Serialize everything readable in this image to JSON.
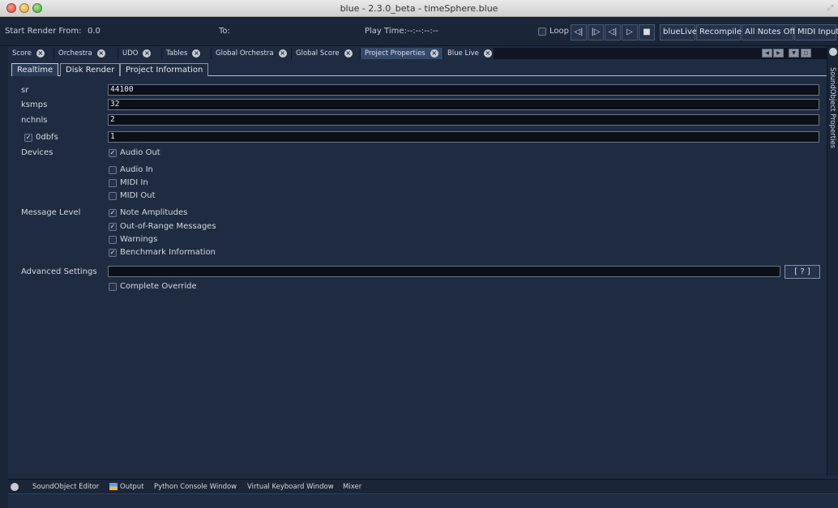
{
  "window": {
    "title": "blue - 2.3.0_beta - timeSphere.blue"
  },
  "toolbar": {
    "start_label": "Start Render From:",
    "start_value": "0.0",
    "to_label": "To:",
    "play_time_label": "Play Time:",
    "play_time_value": "--:--:--:--",
    "loop_label": "Loop",
    "transport_icons": [
      "rewind-icon",
      "step-forward-icon",
      "step-back-icon",
      "play-icon",
      "stop-icon"
    ],
    "buttons": [
      "blueLive",
      "Recompile",
      "All Notes Off",
      "MIDI Input"
    ]
  },
  "main_tabs": [
    {
      "label": "Score"
    },
    {
      "label": "Orchestra"
    },
    {
      "label": "UDO"
    },
    {
      "label": "Tables"
    },
    {
      "label": "Global Orchestra"
    },
    {
      "label": "Global Score"
    },
    {
      "label": "Project Properties",
      "active": true
    },
    {
      "label": "Blue Live"
    }
  ],
  "sub_tabs": [
    {
      "label": "Realtime",
      "active": true
    },
    {
      "label": "Disk Render"
    },
    {
      "label": "Project Information"
    }
  ],
  "form": {
    "sr_label": "sr",
    "sr_value": "44100",
    "ksmps_label": "ksmps",
    "ksmps_value": "32",
    "nchnls_label": "nchnls",
    "nchnls_value": "2",
    "odbfs_label": "0dbfs",
    "odbfs_checked": true,
    "odbfs_value": "1",
    "devices_label": "Devices",
    "devices": [
      {
        "label": "Audio Out",
        "checked": true
      },
      {
        "label": "Audio In",
        "checked": false
      },
      {
        "label": "MIDI In",
        "checked": false
      },
      {
        "label": "MIDI Out",
        "checked": false
      }
    ],
    "message_level_label": "Message Level",
    "messages": [
      {
        "label": "Note Amplitudes",
        "checked": true
      },
      {
        "label": "Out-of-Range Messages",
        "checked": true
      },
      {
        "label": "Warnings",
        "checked": false
      },
      {
        "label": "Benchmark Information",
        "checked": true
      }
    ],
    "advanced_label": "Advanced Settings",
    "advanced_value": "",
    "help_label": "[ ? ]",
    "complete_override_label": "Complete Override",
    "complete_override_checked": false
  },
  "right_panel": {
    "label": "SoundObject Properties"
  },
  "bottom_bar": {
    "items": [
      "SoundObject Editor",
      "Output",
      "Python Console Window",
      "Virtual Keyboard Window",
      "Mixer"
    ]
  },
  "colors": {
    "background": "#1f2b40",
    "active_tab": "#34486a",
    "input_bg": "#0b0f18"
  }
}
